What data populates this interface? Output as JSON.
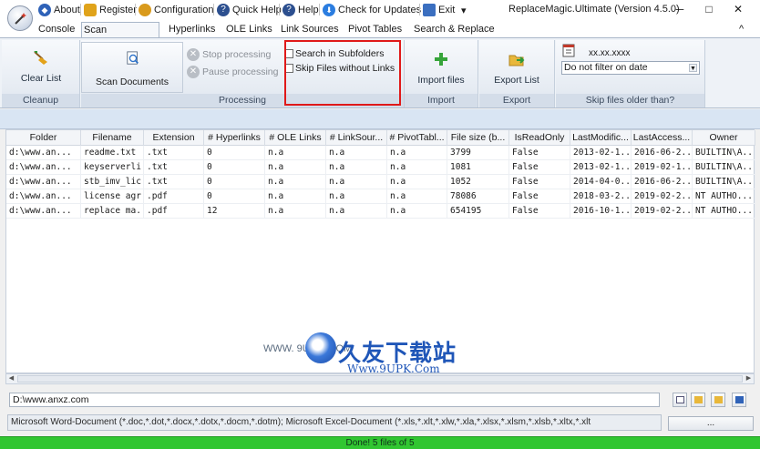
{
  "window": {
    "title": "ReplaceMagic.Ultimate (Version 4.5.0)",
    "minimize": "─",
    "maximize": "□",
    "close": "✕",
    "collapse": "^"
  },
  "quick_access": {
    "about": "About",
    "register": "Register",
    "configuration": "Configuration",
    "quick_help": "Quick Help",
    "help": "Help",
    "check_updates": "Check for Updates",
    "exit": "Exit",
    "dropdown": "▾"
  },
  "tabs": [
    "Console",
    "Scan documents",
    "Hyperlinks",
    "OLE Links",
    "Link Sources",
    "Pivot Tables",
    "Search & Replace"
  ],
  "ribbon": {
    "cleanup": {
      "button": "Clear List",
      "label": "Cleanup"
    },
    "processing": {
      "scan_button": "Scan Documents",
      "stop": "Stop processing",
      "pause": "Pause processing",
      "search_subfolders": "Search in Subfolders",
      "skip_files": "Skip Files without Links",
      "label": "Processing"
    },
    "import": {
      "button": "Import files",
      "label": "Import"
    },
    "export": {
      "button": "Export List",
      "label": "Export"
    },
    "skip_older": {
      "date_text": "xx.xx.xxxx",
      "dropdown_value": "Do not filter on date",
      "label": "Skip files older than?"
    }
  },
  "table": {
    "columns": [
      "Folder",
      "Filename",
      "Extension",
      "# Hyperlinks",
      "# OLE Links",
      "# LinkSour...",
      "# PivotTabl...",
      "File size (b...",
      "IsReadOnly",
      "LastModific...",
      "LastAccess...",
      "Owner"
    ],
    "rows": [
      [
        "d:\\www.an...",
        "readme.txt",
        ".txt",
        "0",
        "n.a",
        "n.a",
        "n.a",
        "3799",
        "False",
        "2013-02-1...",
        "2016-06-2...",
        "BUILTIN\\A..."
      ],
      [
        "d:\\www.an...",
        "keyserverli...",
        ".txt",
        "0",
        "n.a",
        "n.a",
        "n.a",
        "1081",
        "False",
        "2013-02-1...",
        "2019-02-1...",
        "BUILTIN\\A..."
      ],
      [
        "d:\\www.an...",
        "stb_imv_lic...",
        ".txt",
        "0",
        "n.a",
        "n.a",
        "n.a",
        "1052",
        "False",
        "2014-04-0...",
        "2016-06-2...",
        "BUILTIN\\A..."
      ],
      [
        "d:\\www.an...",
        "license agr...",
        ".pdf",
        "0",
        "n.a",
        "n.a",
        "n.a",
        "78086",
        "False",
        "2018-03-2...",
        "2019-02-2...",
        "NT AUTHO..."
      ],
      [
        "d:\\www.an...",
        "replace ma...",
        ".pdf",
        "12",
        "n.a",
        "n.a",
        "n.a",
        "654195",
        "False",
        "2016-10-1...",
        "2019-02-2...",
        "NT AUTHO..."
      ]
    ]
  },
  "path": "D:\\www.anxz.com",
  "filter": "Microsoft Word-Document (*.doc,*.dot,*.docx,*.dotx,*.docm,*.dotm); Microsoft Excel-Document (*.xls,*.xlt,*.xlw,*.xla,*.xlsx,*.xlsm,*.xlsb,*.xltx,*.xlt",
  "browse_button": "...",
  "status": "Done! 5 files of 5",
  "watermark": {
    "side": "WWW. 9UPK .COM",
    "brand": "久友下载站",
    "url": "Www.9UPK.Com"
  }
}
